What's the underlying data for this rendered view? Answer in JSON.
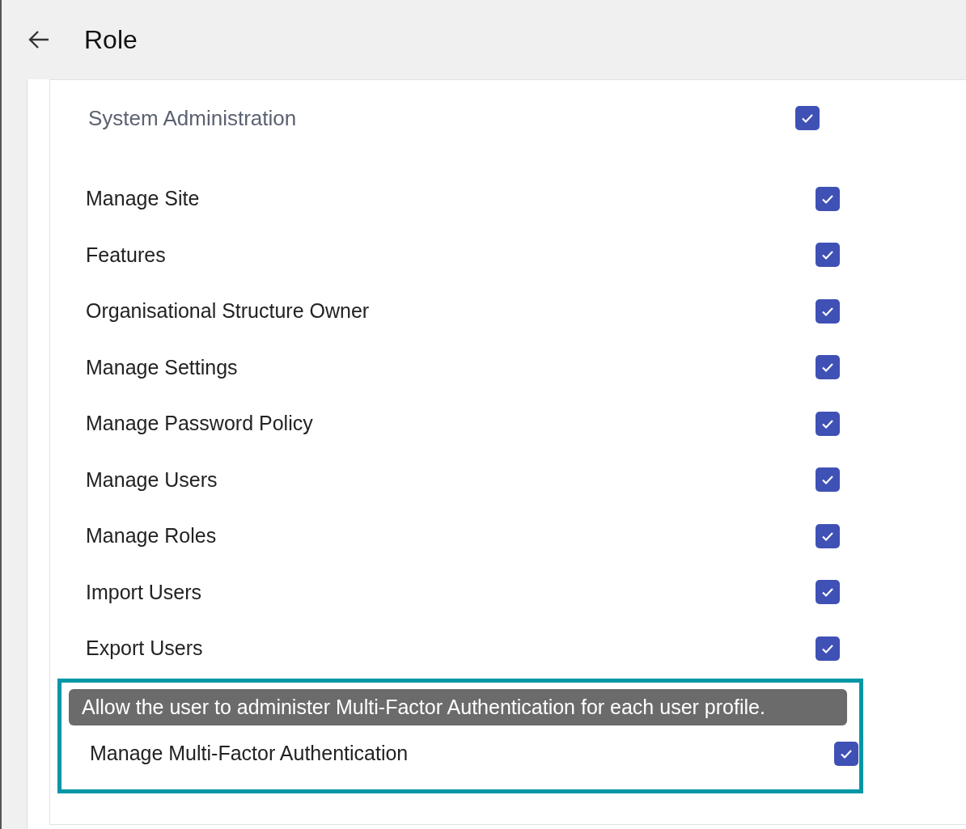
{
  "header": {
    "title": "Role"
  },
  "section": {
    "title": "System Administration",
    "checked": true
  },
  "permissions": [
    {
      "label": "Manage Site",
      "checked": true
    },
    {
      "label": "Features",
      "checked": true
    },
    {
      "label": "Organisational Structure Owner",
      "checked": true
    },
    {
      "label": "Manage Settings",
      "checked": true
    },
    {
      "label": "Manage Password Policy",
      "checked": true
    },
    {
      "label": "Manage Users",
      "checked": true
    },
    {
      "label": "Manage Roles",
      "checked": true
    },
    {
      "label": "Import Users",
      "checked": true
    },
    {
      "label": "Export Users",
      "checked": true
    }
  ],
  "highlight": {
    "tooltip": "Allow the user to administer Multi-Factor Authentication for each user profile.",
    "permission": {
      "label": "Manage Multi-Factor Authentication",
      "checked": true
    }
  }
}
